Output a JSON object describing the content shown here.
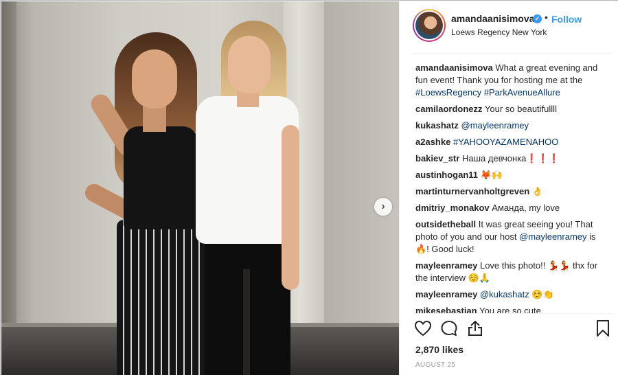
{
  "post": {
    "username": "amandaanisimova",
    "verified_mark": "✓",
    "separator": "•",
    "follow_label": "Follow",
    "location": "Loews Regency New York"
  },
  "caption": {
    "username": "amandaanisimova",
    "text": "What a great evening and fun event! Thank you for hosting me at the",
    "tags": [
      "#LoewsRegency",
      "#ParkAvenueAllure"
    ]
  },
  "comments": [
    {
      "user": "camilaordonezz",
      "text": "Your so beautifullll"
    },
    {
      "user": "kukashatz",
      "tag": "@mayleenramey"
    },
    {
      "user": "a2ashke",
      "tag": "#YAHOOYAZAMENAHOO"
    },
    {
      "user": "bakiev_str",
      "text": "Наша девчонка❗️❗️❗️"
    },
    {
      "user": "austinhogan11",
      "text": "🦊🙌"
    },
    {
      "user": "martinturnervanholtgreven",
      "text": "👌"
    },
    {
      "user": "dmitriy_monakov",
      "text": "Аманда, my love"
    },
    {
      "user": "outsidetheball",
      "text": "It was great seeing you! That photo of you and our host",
      "tag": "@mayleenramey",
      "text_after": "is 🔥! Good luck!"
    },
    {
      "user": "mayleenramey",
      "text": "Love this photo!! 💃💃 thx for the interview ☺️🙏"
    },
    {
      "user": "mayleenramey",
      "tag": "@kukashatz",
      "text_after": "☺️👏"
    },
    {
      "user": "mikesebastian",
      "text": "You are so cute"
    }
  ],
  "actions": {
    "like_icon": "heart-icon",
    "comment_icon": "comment-bubble-icon",
    "share_icon": "share-icon",
    "save_icon": "bookmark-icon"
  },
  "likes_label": "2,870 likes",
  "date_label": "AUGUST 25",
  "carousel": {
    "next_label": "›"
  }
}
